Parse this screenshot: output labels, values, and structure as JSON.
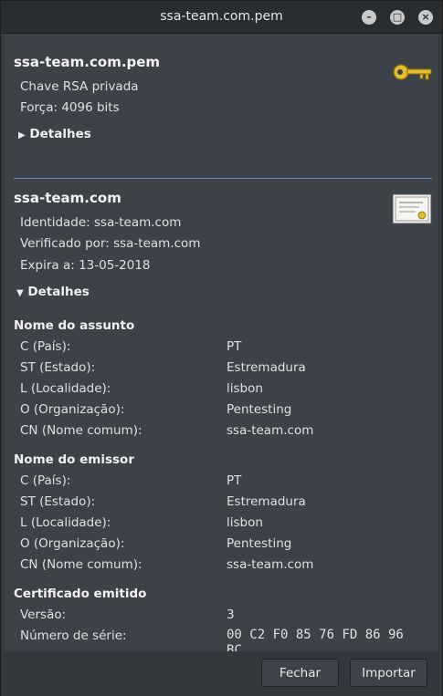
{
  "window": {
    "title": "ssa-team.com.pem"
  },
  "key": {
    "name": "ssa-team.com.pem",
    "type": "Chave RSA privada",
    "strength": "Força: 4096 bits",
    "details_label": "Detalhes",
    "icon": "key-icon"
  },
  "cert": {
    "name": "ssa-team.com",
    "identity": "Identidade: ssa-team.com",
    "verified_by": "Verificado por: ssa-team.com",
    "expires": "Expira a: 13-05-2018",
    "details_label": "Detalhes",
    "icon": "certificate-icon"
  },
  "subject": {
    "title": "Nome do assunto",
    "rows": [
      {
        "label": "C (País):",
        "value": "PT"
      },
      {
        "label": "ST (Estado):",
        "value": "Estremadura"
      },
      {
        "label": "L (Localidade):",
        "value": "lisbon"
      },
      {
        "label": "O (Organização):",
        "value": "Pentesting"
      },
      {
        "label": "CN (Nome comum):",
        "value": "ssa-team.com"
      }
    ]
  },
  "issuer": {
    "title": "Nome do emissor",
    "rows": [
      {
        "label": "C (País):",
        "value": "PT"
      },
      {
        "label": "ST (Estado):",
        "value": "Estremadura"
      },
      {
        "label": "L (Localidade):",
        "value": "lisbon"
      },
      {
        "label": "O (Organização):",
        "value": "Pentesting"
      },
      {
        "label": "CN (Nome comum):",
        "value": "ssa-team.com"
      }
    ]
  },
  "issued": {
    "title": "Certificado emitido",
    "rows": [
      {
        "label": "Versão:",
        "value": "3"
      },
      {
        "label": "Número de série:",
        "value": "00 C2 F0 85 76 FD 86 96"
      }
    ],
    "serial_overflow": "BC"
  },
  "buttons": {
    "close": "Fechar",
    "import": "Importar"
  },
  "colors": {
    "accent": "#5a8fb8",
    "key_gold": "#e3c02b"
  }
}
